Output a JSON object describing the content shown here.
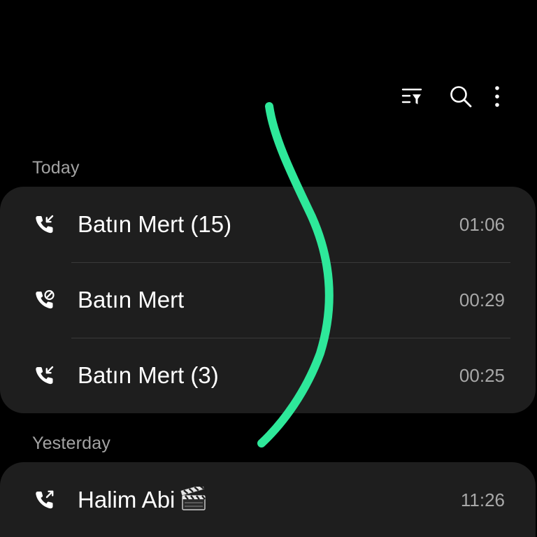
{
  "toolbar": {
    "filter_icon": "filter-list-icon",
    "search_icon": "search-icon",
    "more_icon": "more-vertical-icon"
  },
  "sections": [
    {
      "header": "Today",
      "calls": [
        {
          "name": "Batın Mert (15)",
          "time": "01:06",
          "type": "incoming",
          "icon": "incoming-call-icon"
        },
        {
          "name": "Batın Mert",
          "time": "00:29",
          "type": "rejected",
          "icon": "rejected-call-icon"
        },
        {
          "name": "Batın Mert (3)",
          "time": "00:25",
          "type": "incoming",
          "icon": "incoming-call-icon"
        }
      ]
    },
    {
      "header": "Yesterday",
      "calls": [
        {
          "name": "Halim Abi",
          "time": "11:26",
          "type": "outgoing",
          "icon": "outgoing-call-icon",
          "emoji_icon": "clapper-board-icon"
        }
      ]
    }
  ],
  "colors": {
    "background": "#000000",
    "card": "#1e1e1e",
    "header_text": "#a3a3a3",
    "time_text": "#a8a8a8",
    "annotation_stroke": "#2ee89a"
  }
}
